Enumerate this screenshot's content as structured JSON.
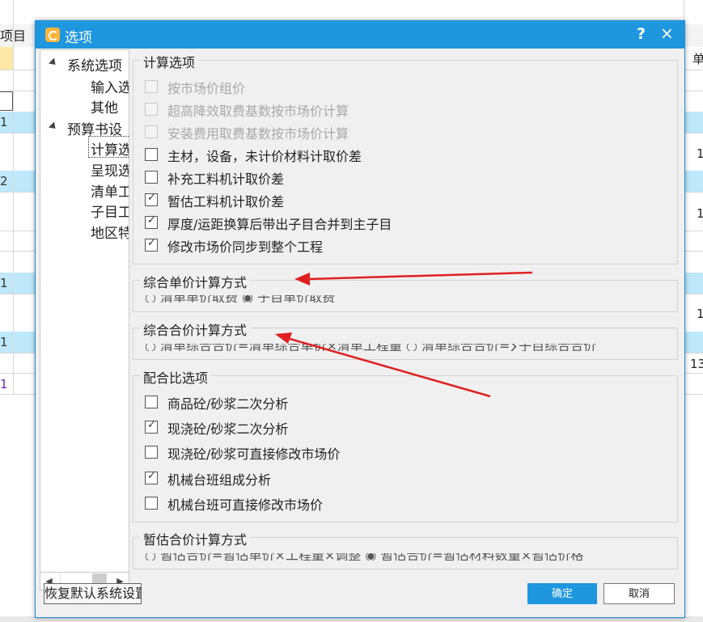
{
  "background": {
    "header_cell": "项目",
    "header_cell_right": "单",
    "row_numbers": [
      "1",
      "2",
      "1",
      "1",
      "1"
    ],
    "right_values": [
      "1",
      "1",
      "1",
      "13"
    ]
  },
  "dialog": {
    "title": "选项",
    "help": "?",
    "close": "×",
    "tree": {
      "items": [
        {
          "label": "系统选项",
          "level": 0,
          "expanded": true
        },
        {
          "label": "输入选",
          "level": 1
        },
        {
          "label": "其他",
          "level": 1
        },
        {
          "label": "预算书设",
          "level": 0,
          "expanded": true
        },
        {
          "label": "计算选",
          "level": 1,
          "selected": true
        },
        {
          "label": "呈现选",
          "level": 1
        },
        {
          "label": "清单工",
          "level": 1
        },
        {
          "label": "子目工",
          "level": 1
        },
        {
          "label": "地区特",
          "level": 1
        }
      ]
    },
    "calc_options": {
      "title": "计算选项",
      "items": [
        {
          "label": "按市场价组价",
          "checked": false,
          "disabled": true
        },
        {
          "label": "超高降效取费基数按市场价计算",
          "checked": false,
          "disabled": true
        },
        {
          "label": "安装费用取费基数按市场价计算",
          "checked": false,
          "disabled": true
        },
        {
          "label": "主材，设备，未计价材料计取价差",
          "checked": false,
          "disabled": false
        },
        {
          "label": "补充工料机计取价差",
          "checked": false,
          "disabled": false
        },
        {
          "label": "暂估工料机计取价差",
          "checked": true,
          "disabled": false
        },
        {
          "label": "厚度/运距换算后带出子目合并到主子目",
          "checked": true,
          "disabled": false
        },
        {
          "label": "修改市场价同步到整个工程",
          "checked": true,
          "disabled": false
        }
      ]
    },
    "unit_price_method": {
      "title": "综合单价计算方式",
      "clipped_text": "○   清单单价取费   ◉   子目单价取费"
    },
    "total_price_method": {
      "title": "综合合价计算方式",
      "clipped_text": "○   清单综合合价=清单综合单价×清单工程量   ○   清单综合合价=∑子目综合合价"
    },
    "mix_options": {
      "title": "配合比选项",
      "items": [
        {
          "label": "商品砼/砂浆二次分析",
          "checked": false
        },
        {
          "label": "现浇砼/砂浆二次分析",
          "checked": true
        },
        {
          "label": "现浇砼/砂浆可直接修改市场价",
          "checked": false
        },
        {
          "label": "机械台班组成分析",
          "checked": true
        },
        {
          "label": "机械台班可直接修改市场价",
          "checked": false
        }
      ]
    },
    "estimate_method": {
      "title": "暂估合价计算方式",
      "clipped_text": "○   暂估合价=暂估单价×工程量×调整   ◉   暂估合价=暂估材料数量×暂估价格"
    },
    "buttons": {
      "reset": "恢复默认系统设置",
      "ok": "确定",
      "cancel": "取消"
    }
  },
  "colors": {
    "titlebar": "#1e97de",
    "annotation_arrow": "#e02020"
  }
}
